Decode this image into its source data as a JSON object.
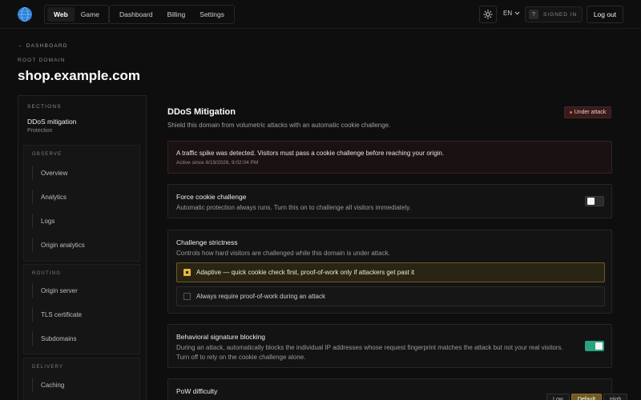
{
  "topbar": {
    "seg_tabs": [
      "Web",
      "Game"
    ],
    "active_seg": "Web",
    "nav": [
      "Dashboard",
      "Billing",
      "Settings"
    ],
    "lang": "EN",
    "help": "?",
    "signed_in": "SIGNED IN",
    "logout": "Log out"
  },
  "header": {
    "back": "← DASHBOARD",
    "root_label": "ROOT DOMAIN",
    "domain": "shop.example.com"
  },
  "sidebar": {
    "sections_label": "SECTIONS",
    "current": {
      "title": "DDoS mitigation",
      "subtitle": "Protection"
    },
    "groups": [
      {
        "label": "OBSERVE",
        "items": [
          "Overview",
          "Analytics",
          "Logs",
          "Origin analytics"
        ]
      },
      {
        "label": "ROUTING",
        "items": [
          "Origin server",
          "TLS certificate",
          "Subdomains"
        ]
      },
      {
        "label": "DELIVERY",
        "items": [
          "Caching"
        ]
      }
    ]
  },
  "main": {
    "title": "DDoS Mitigation",
    "subtitle": "Shield this domain from volumetric attacks with an automatic cookie challenge.",
    "status_badge": "Under attack",
    "alert": {
      "text": "A traffic spike was detected. Visitors must pass a cookie challenge before reaching your origin.",
      "time": "Active since 8/19/2026, 9:02:04 PM"
    },
    "force_cookie": {
      "title": "Force cookie challenge",
      "desc": "Automatic protection always runs. Turn this on to challenge all visitors immediately.",
      "enabled": false
    },
    "strictness": {
      "title": "Challenge strictness",
      "desc": "Controls how hard visitors are challenged while this domain is under attack.",
      "options": [
        {
          "label": "Adaptive — quick cookie check first, proof-of-work only if attackers get past it",
          "selected": true
        },
        {
          "label": "Always require proof-of-work during an attack",
          "selected": false
        }
      ]
    },
    "behavioral": {
      "title": "Behavioral signature blocking",
      "desc_line1": "During an attack, automatically blocks the individual IP addresses whose request fingerprint matches the attack but not your real visitors.",
      "desc_line2": "Turn off to rely on the cookie challenge alone.",
      "enabled": true
    },
    "pow": {
      "title": "PoW difficulty",
      "levels": [
        "Low",
        "Default",
        "High"
      ],
      "active": "Default"
    }
  },
  "colors": {
    "accent_green": "#27a37f",
    "accent_amber": "#e8b63a",
    "danger": "#e06a5a"
  }
}
